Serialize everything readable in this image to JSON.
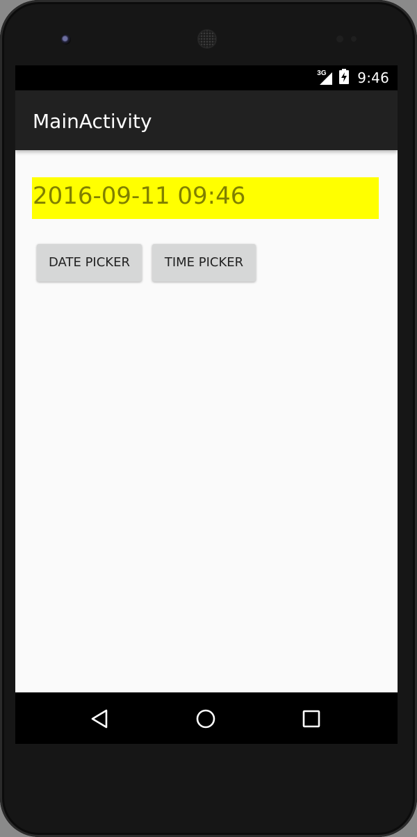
{
  "status_bar": {
    "network_type": "3G",
    "time": "9:46"
  },
  "app_bar": {
    "title": "MainActivity"
  },
  "main": {
    "datetime_value": "2016-09-11 09:46",
    "date_picker_label": "DATE PICKER",
    "time_picker_label": "TIME PICKER"
  },
  "nav_bar": {
    "icons": [
      "back-icon",
      "home-icon",
      "recent-apps-icon"
    ]
  },
  "colors": {
    "datetime_background": "#ffff00",
    "datetime_text": "#808000",
    "app_bar": "#212121",
    "button_background": "#d6d7d7"
  }
}
